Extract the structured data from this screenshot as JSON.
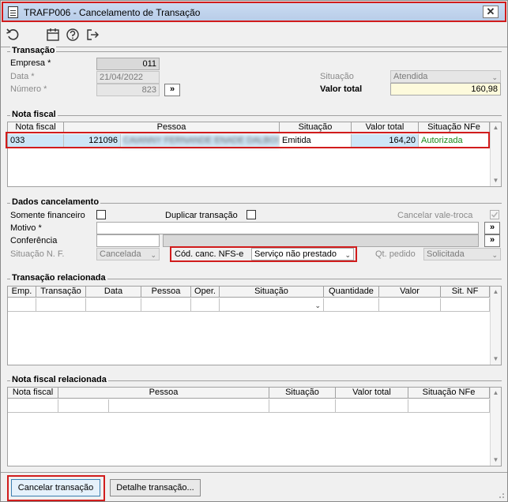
{
  "window": {
    "title": "TRAFP006 - Cancelamento de Transação",
    "close_label": "✕"
  },
  "toolbar": {
    "icons": [
      "undo-icon",
      "calendar-icon",
      "help-icon",
      "exit-icon"
    ]
  },
  "transacao": {
    "title": "Transação",
    "empresa_label": "Empresa *",
    "empresa_value": "011",
    "data_label": "Data *",
    "data_value": "21/04/2022",
    "numero_label": "Número *",
    "numero_value": "823",
    "go_label": "»",
    "situacao_label": "Situação",
    "situacao_value": "Atendida",
    "valor_total_label": "Valor total",
    "valor_total_value": "160,98"
  },
  "nota_fiscal": {
    "title": "Nota fiscal",
    "columns": [
      "Nota fiscal",
      "Pessoa",
      "Situação",
      "Valor total",
      "Situação NFe"
    ],
    "row": {
      "nota": "033",
      "pessoa_codigo": "121096",
      "pessoa_nome": "CAIANNY FERNANDE ENADE DALBOS",
      "situacao": "Emitida",
      "valor": "164,20",
      "situacao_nfe": "Autorizada"
    }
  },
  "dados": {
    "title": "Dados cancelamento",
    "somente_financeiro_label": "Somente financeiro",
    "duplicar_label": "Duplicar transação",
    "cancelar_vale_label": "Cancelar vale-troca",
    "motivo_label": "Motivo *",
    "motivo_value": "",
    "conferencia_label": "Conferência",
    "conferencia_value": "",
    "go_label": "»",
    "situacao_nf_label": "Situação N. F.",
    "situacao_nf_value": "Cancelada",
    "cod_canc_label": "Cód. canc. NFS-e",
    "cod_canc_value": "Serviço não prestado",
    "qt_pedido_label": "Qt. pedido",
    "qt_pedido_value": "Solicitada"
  },
  "transacao_rel": {
    "title": "Transação relacionada",
    "columns": [
      "Emp.",
      "Transação",
      "Data",
      "Pessoa",
      "Oper.",
      "Situação",
      "Quantidade",
      "Valor",
      "Sit. NF"
    ]
  },
  "nota_rel": {
    "title": "Nota fiscal relacionada",
    "columns": [
      "Nota fiscal",
      "Pessoa",
      "Situação",
      "Valor total",
      "Situação NFe"
    ]
  },
  "buttons": {
    "cancelar": "Cancelar transação",
    "detalhe": "Detalhe transação..."
  },
  "colors": {
    "highlight": "#d11c1c",
    "selected_row": "#cde6f7",
    "authorized": "#1a8a1a",
    "total_field": "#fdfadc"
  }
}
